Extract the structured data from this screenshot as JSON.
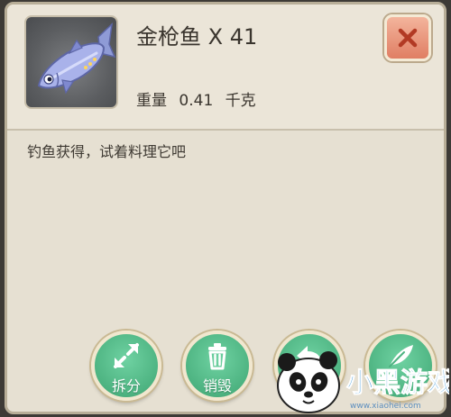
{
  "item": {
    "name": "金枪鱼 X 41",
    "icon": "tuna-fish-icon",
    "weight_label": "重量",
    "weight_value": "0.41",
    "weight_unit": "千克",
    "description": "钓鱼获得，试着料理它吧"
  },
  "close_button": {
    "icon": "close-icon",
    "color": "#e07e63"
  },
  "actions": [
    {
      "label": "拆分",
      "icon": "split-arrows-icon"
    },
    {
      "label": "销毁",
      "icon": "trash-icon"
    },
    {
      "label": "",
      "icon": "return-arrow-icon"
    },
    {
      "label": "",
      "icon": "feather-icon"
    }
  ],
  "colors": {
    "panel_bg": "#e6e0d2",
    "action_green": "#4db381",
    "close_red": "#e07e63"
  },
  "watermark": {
    "title": "小黑游戏",
    "url": "www.xiaohei.com"
  }
}
